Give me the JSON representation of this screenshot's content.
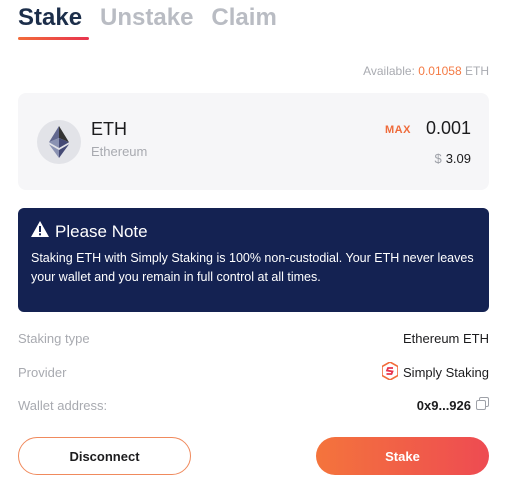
{
  "tabs": [
    {
      "label": "Stake",
      "active": true
    },
    {
      "label": "Unstake",
      "active": false
    },
    {
      "label": "Claim",
      "active": false
    }
  ],
  "available": {
    "label": "Available:",
    "amount": "0.01058",
    "unit": "ETH"
  },
  "asset": {
    "icon": "ethereum-icon",
    "symbol": "ETH",
    "name": "Ethereum",
    "max_label": "MAX",
    "amount": "0.001",
    "usd_symbol": "$",
    "usd_value": "3.09"
  },
  "note": {
    "icon": "warning-icon",
    "title": "Please Note",
    "body": "Staking ETH with Simply Staking is 100% non-custodial. Your ETH never leaves your wallet and you remain in full control at all times."
  },
  "details": {
    "staking_type": {
      "label": "Staking type",
      "value": "Ethereum ETH"
    },
    "provider": {
      "label": "Provider",
      "value": "Simply Staking",
      "icon": "simply-staking-logo"
    },
    "wallet": {
      "label": "Wallet address:",
      "value": "0x9...926",
      "icon": "copy-icon"
    }
  },
  "buttons": {
    "disconnect": "Disconnect",
    "stake": "Stake"
  },
  "colors": {
    "accent_orange": "#f4743c",
    "accent_red": "#ee4b52",
    "note_bg": "#142252",
    "tab_active": "#1c2e4a",
    "tab_inactive": "#b9bcc3"
  }
}
